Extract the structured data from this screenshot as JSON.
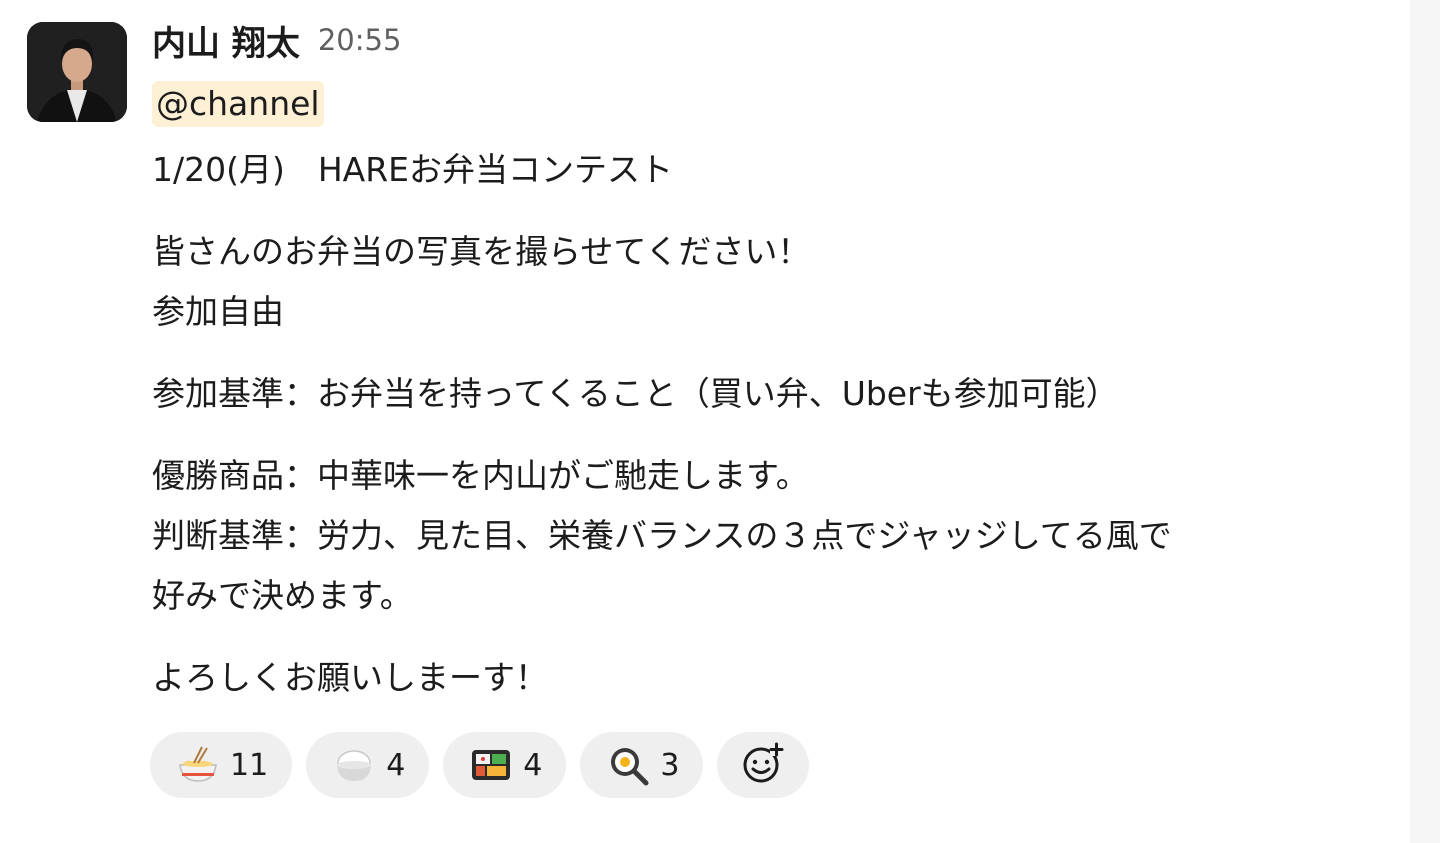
{
  "message": {
    "author": "内山 翔太",
    "timestamp": "20:55",
    "mention": "@channel",
    "lines": {
      "title": "1/20(月)　HAREお弁当コンテスト",
      "p1_l1": "皆さんのお弁当の写真を撮らせてください！",
      "p1_l2": "参加自由",
      "p2_l1": "参加基準：お弁当を持ってくること（買い弁、Uberも参加可能）",
      "p3_l1": "優勝商品：中華味一を内山がご馳走します。",
      "p3_l2": "判断基準：労力、見た目、栄養バランスの３点でジャッジしてる風で",
      "p3_l3": "好みで決めます。",
      "p4_l1": "よろしくお願いしまーす！"
    }
  },
  "reactions": [
    {
      "icon": "ramen-icon",
      "count": "11"
    },
    {
      "icon": "rice-icon",
      "count": "4"
    },
    {
      "icon": "bento-icon",
      "count": "4"
    },
    {
      "icon": "fried-egg-icon",
      "count": "3"
    }
  ],
  "add_reaction_icon": "add-reaction-icon",
  "colors": {
    "mention_bg": "#fdf0d5",
    "reaction_bg": "#efefef",
    "timestamp": "#616061"
  }
}
